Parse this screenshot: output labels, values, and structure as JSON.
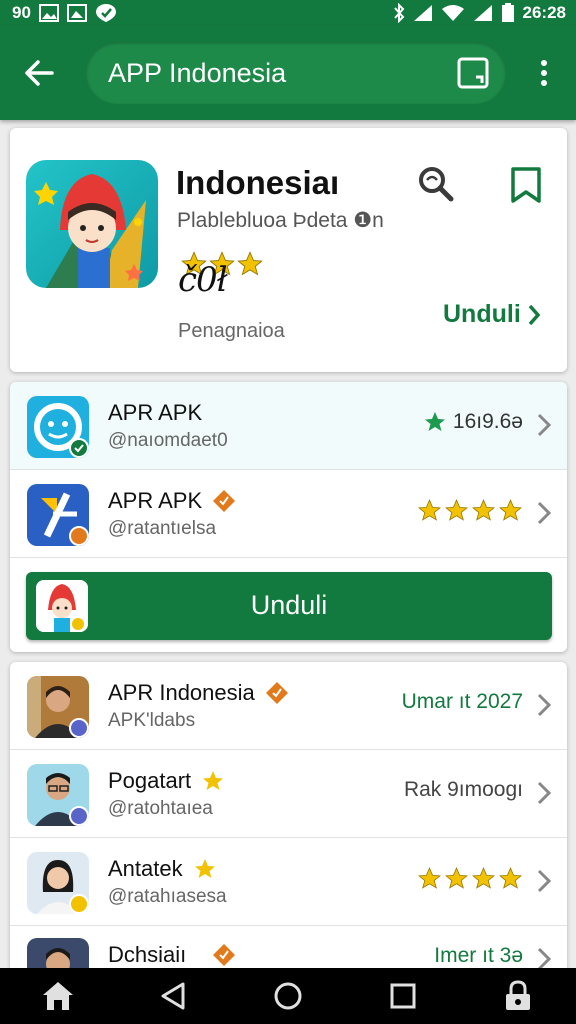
{
  "status_bar": {
    "left_text": "90",
    "time": "26:28",
    "icons": [
      "image-icon",
      "photo-icon",
      "shield-icon",
      "bluetooth-icon",
      "signal-icon",
      "wifi-icon",
      "signal-icon",
      "battery-icon"
    ]
  },
  "app_bar": {
    "search_text": "APP Indonesia",
    "icons": [
      "back-arrow-icon",
      "save-icon",
      "more-vert-icon"
    ]
  },
  "hero": {
    "title": "Indonesiaı",
    "subtitle": "Plablebluoa Þdeta ❶n",
    "rating": "č0ł",
    "rating_stars": 3,
    "meta": "Penagnaioa",
    "download_label": "Unduli",
    "icons": [
      "app-character-icon",
      "search-icon",
      "bookmark-icon",
      "chevron-right-icon"
    ]
  },
  "list1": {
    "rows": [
      {
        "name": "APR APK",
        "handle": "@naıomdaet0",
        "right": "16ı9.6ə",
        "right_type": "star-count",
        "icon": "face-app-icon"
      },
      {
        "name": "APR APK",
        "handle": "@ratantıelsa",
        "right": "",
        "right_type": "stars",
        "stars": 4,
        "icon": "slash-app-icon"
      }
    ],
    "download_label": "Unduli"
  },
  "list2": {
    "rows": [
      {
        "name": "APR Indonesia",
        "handle": "APK'ldabs",
        "right": "Umar ıt 2027",
        "right_type": "green-text",
        "icon": "person-avatar-icon"
      },
      {
        "name": "Pogatart",
        "handle": "@ratohtaıea",
        "right": "Rak 9ımoogı",
        "right_type": "gray-text",
        "icon": "person-avatar-icon"
      },
      {
        "name": "Antatek",
        "handle": "@ratahıasesa",
        "right": "",
        "right_type": "stars",
        "stars": 4,
        "icon": "person-avatar-icon"
      },
      {
        "name": "Dchsiaiı",
        "handle": "",
        "right": "Imer ıt 3ə",
        "right_type": "green-text",
        "icon": "person-avatar-icon"
      }
    ]
  },
  "nav_bar": {
    "icons": [
      "home-icon",
      "back-triangle-icon",
      "home-circle-icon",
      "recents-square-icon",
      "lock-icon"
    ]
  },
  "colors": {
    "brand_green": "#137a3f",
    "star_yellow": "#f2c200",
    "badge_orange": "#e27a1c"
  }
}
